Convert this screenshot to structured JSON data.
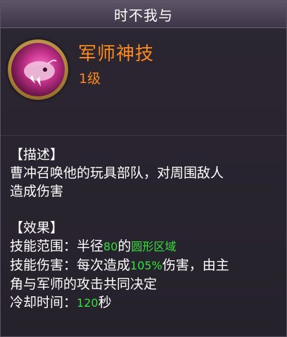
{
  "window": {
    "title": "时不我与"
  },
  "skill": {
    "name": "军师神技",
    "level": "1级",
    "icon": "pink-beast-icon"
  },
  "description": {
    "heading": "【描述】",
    "line1": "曹冲召唤他的玩具部队，对周围敌人",
    "line2": "造成伤害"
  },
  "effect": {
    "heading": "【效果】",
    "range_label": "技能范围：半径",
    "range_value": "80",
    "range_mid": "的",
    "range_area": "圆形区域",
    "damage_label": "技能伤害：每次造成",
    "damage_value": "105%",
    "damage_suffix": "伤害，由主",
    "damage_line2": "角与军师的攻击共同决定",
    "cooldown_label": "冷却时间：",
    "cooldown_value": "120",
    "cooldown_unit": "秒"
  },
  "colors": {
    "accent": "#ff8a1c",
    "highlight": "#34e23c",
    "text": "#ffffff"
  }
}
